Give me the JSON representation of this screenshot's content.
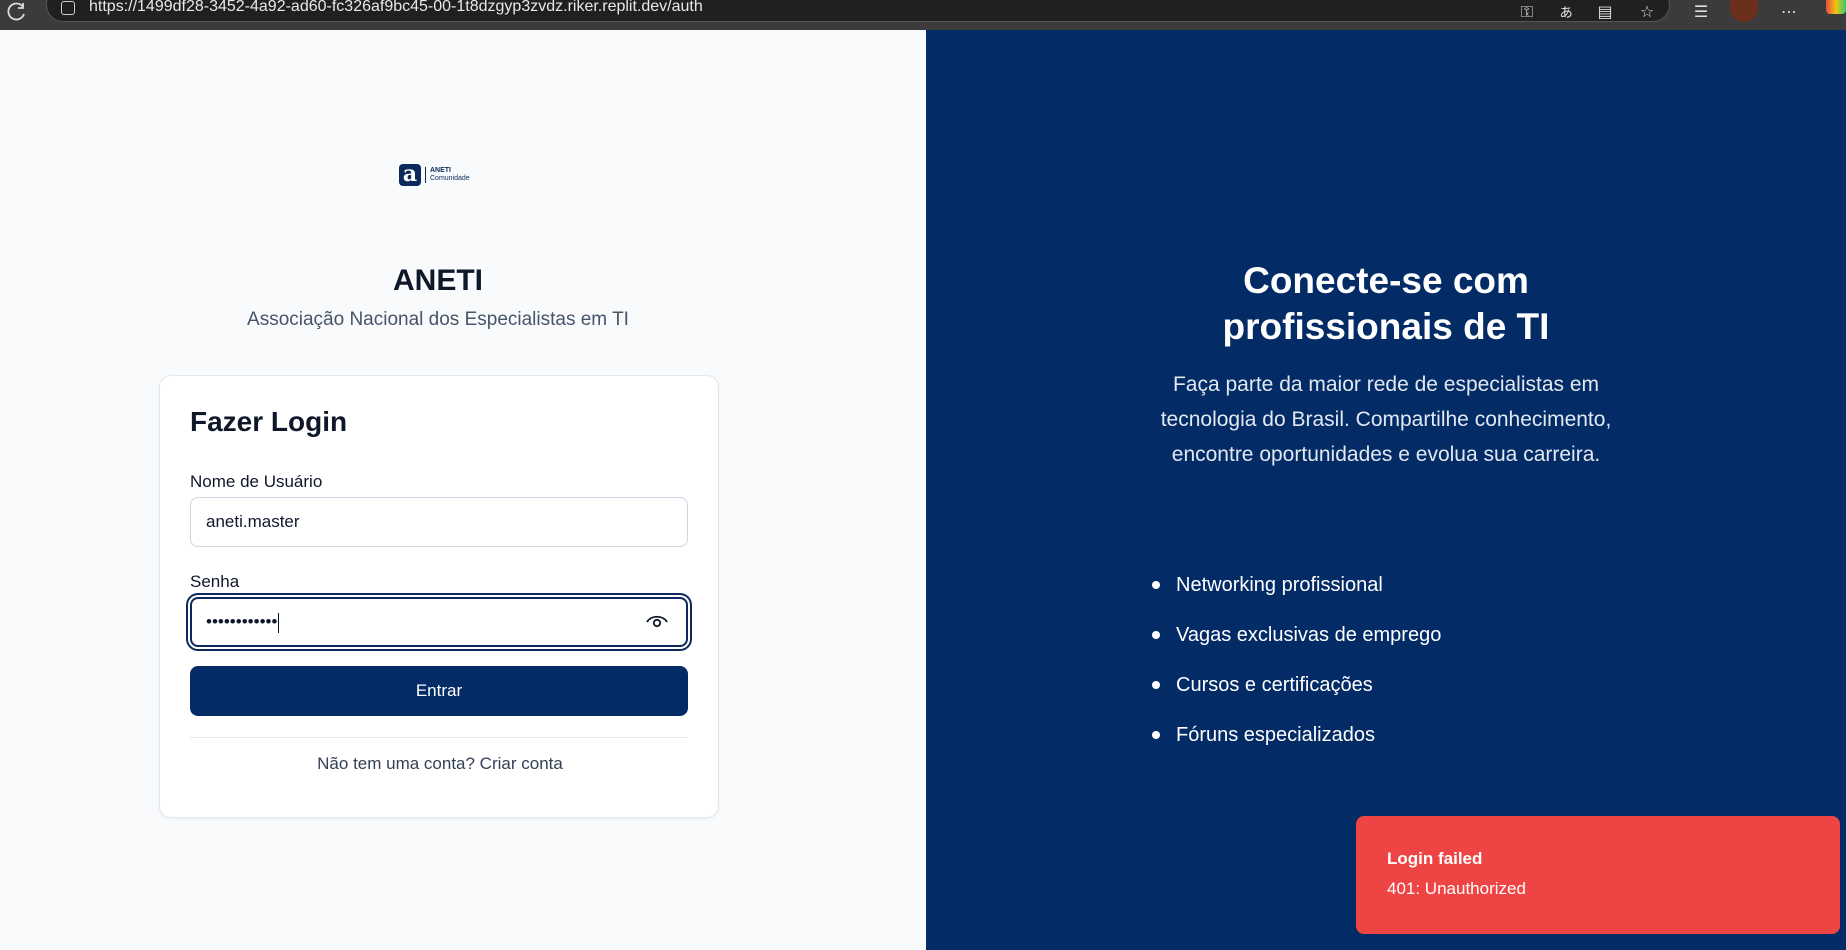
{
  "browser": {
    "url": "https://1499df28-3452-4a92-ad60-fc326af9bc45-00-1t8dzgyp3zvdz.riker.replit.dev/auth"
  },
  "logo": {
    "mark": "a",
    "line1": "ANETI",
    "line2": "Comunidade"
  },
  "brand": {
    "title": "ANETI",
    "subtitle": "Associação Nacional dos Especialistas em TI"
  },
  "login": {
    "title": "Fazer Login",
    "username_label": "Nome de Usuário",
    "username_value": "aneti.master",
    "password_label": "Senha",
    "password_masked": "••••••••••••",
    "submit_label": "Entrar",
    "signup_prompt": "Não tem uma conta? Criar conta"
  },
  "hero": {
    "title_line1": "Conecte-se com",
    "title_line2": "profissionais de TI",
    "description": "Faça parte da maior rede de especialistas em tecnologia do Brasil. Compartilhe conhecimento, encontre oportunidades e evolua sua carreira.",
    "features": [
      "Networking profissional",
      "Vagas exclusivas de emprego",
      "Cursos e certificações",
      "Fóruns especializados"
    ]
  },
  "toast": {
    "title": "Login failed",
    "message": "401: Unauthorized"
  },
  "colors": {
    "navy": "#032b66",
    "toast_red": "#ef4444"
  }
}
